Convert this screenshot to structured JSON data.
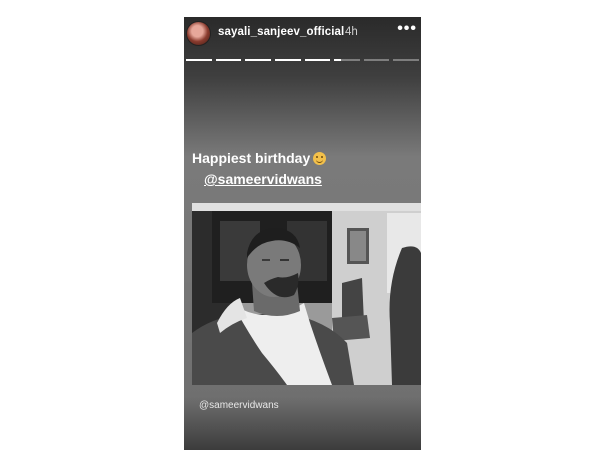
{
  "story": {
    "username": "sayali_sanjeev_official",
    "time": "4h",
    "more_icon": "•••",
    "progress_segments": [
      1,
      1,
      1,
      1,
      1,
      0.25,
      0,
      0
    ],
    "caption_line1": "Happiest birthday",
    "caption_emoji": "hugging-face-emoji",
    "caption_mention": "@sameervidwans",
    "photo_tag": "@sameervidwans"
  }
}
